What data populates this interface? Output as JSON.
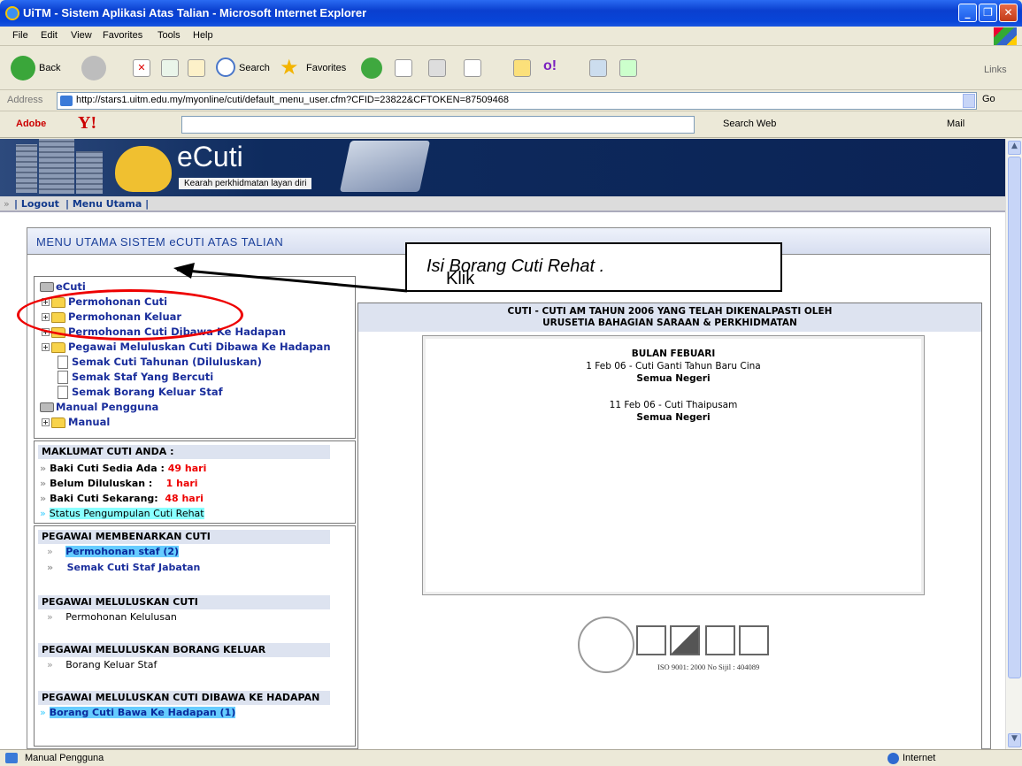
{
  "window": {
    "title": "UiTM - Sistem Aplikasi Atas Talian - Microsoft Internet Explorer"
  },
  "menu": [
    "File",
    "Edit",
    "View",
    "Favorites",
    "Tools",
    "Help"
  ],
  "toolbar": {
    "back": "Back",
    "search": "Search",
    "favorites": "Favorites",
    "links": "Links"
  },
  "address": {
    "label": "Address",
    "url": "http://stars1.uitm.edu.my/myonline/cuti/default_menu_user.cfm?CFID=23822&CFTOKEN=87509468",
    "go": "Go"
  },
  "yahoo": {
    "adobe": "Adobe",
    "search_web": "Search Web",
    "mail": "Mail"
  },
  "banner": {
    "app_name": "eCuti",
    "slogan": "Kearah perkhidmatan layan diri"
  },
  "nav": {
    "logout": "| Logout",
    "menu_utama": "| Menu Utama |"
  },
  "main": {
    "title": "MENU UTAMA SISTEM eCUTI ATAS TALIAN"
  },
  "tree": {
    "root": "eCuti",
    "items": [
      "Permohonan Cuti",
      "Permohonan Keluar",
      "Permohonan Cuti Dibawa Ke Hadapan",
      "Pegawai Meluluskan Cuti Dibawa Ke Hadapan",
      "Semak Cuti Tahunan (Diluluskan)",
      "Semak Staf Yang Bercuti",
      "Semak Borang Keluar Staf"
    ],
    "manual_root": "Manual Pengguna",
    "manual_item": "Manual"
  },
  "maklumat": {
    "heading": "MAKLUMAT CUTI ANDA :",
    "rows": [
      {
        "label": "Baki Cuti Sedia Ada :",
        "value": "49 hari"
      },
      {
        "label": "Belum Diluluskan :",
        "value": "1 hari"
      },
      {
        "label": "Baki Cuti Sekarang:",
        "value": "48 hari"
      }
    ],
    "status_link": "Status Pengumpulan Cuti Rehat"
  },
  "approvals": [
    {
      "heading": "PEGAWAI MEMBENARKAN CUTI",
      "items": [
        "Permohonan staf (2)",
        "Semak Cuti Staf Jabatan"
      ]
    },
    {
      "heading": "PEGAWAI MELULUSKAN CUTI",
      "items": [
        "Permohonan Kelulusan"
      ]
    },
    {
      "heading": "PEGAWAI MELULUSKAN BORANG KELUAR",
      "items": [
        "Borang Keluar Staf"
      ]
    },
    {
      "heading": "PEGAWAI MELULUSKAN CUTI DIBAWA KE HADAPAN",
      "items": [
        "Borang Cuti Bawa Ke Hadapan  (1)"
      ]
    }
  ],
  "holidays": {
    "header_line1": "CUTI - CUTI AM TAHUN 2006 YANG TELAH DIKENALPASTI OLEH",
    "header_line2": "URUSETIA BAHAGIAN SARAAN & PERKHIDMATAN",
    "month": "BULAN FEBUARI",
    "entries": [
      {
        "desc": "1 Feb 06 - Cuti Ganti Tahun Baru Cina",
        "region": "Semua Negeri"
      },
      {
        "desc": "11 Feb 06 - Cuti Thaipusam",
        "region": "Semua Negeri"
      }
    ]
  },
  "iso": {
    "text": "ISO 9001: 2000  No Sijil : 404089"
  },
  "callout": {
    "prefix": "Klik ",
    "italic": "Isi Borang Cuti Rehat ."
  },
  "status": {
    "left": "Manual Pengguna",
    "zone": "Internet"
  }
}
